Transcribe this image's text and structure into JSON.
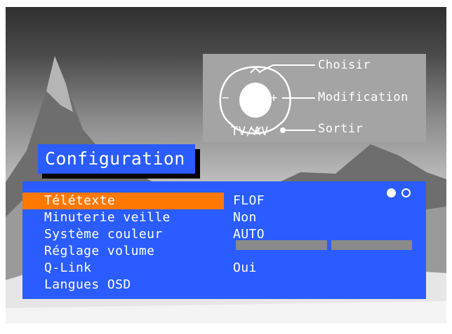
{
  "help_panel": {
    "choose_label": "Choisir",
    "modify_label": "Modification",
    "exit_label": "Sortir",
    "tvav_label": "TV/AV",
    "plus_glyph": "+",
    "minus_glyph": "−"
  },
  "menu": {
    "title": "Configuration",
    "items": [
      {
        "label": "Télétexte",
        "value": "FLOF",
        "selected": true
      },
      {
        "label": "Minuterie veille",
        "value": "Non"
      },
      {
        "label": "Système couleur",
        "value": "AUTO"
      },
      {
        "label": "Réglage volume",
        "value": ""
      },
      {
        "label": "Q-Link",
        "value": "Oui"
      },
      {
        "label": "Langues OSD",
        "value": ""
      }
    ],
    "teletext_indicator": {
      "total": 2,
      "active": 1
    },
    "volume_bars": 2
  },
  "colors": {
    "menu_bg": "#2a5cff",
    "highlight": "#ff7800",
    "panel_bg": "#a4a4a4",
    "text": "#ffffff"
  }
}
